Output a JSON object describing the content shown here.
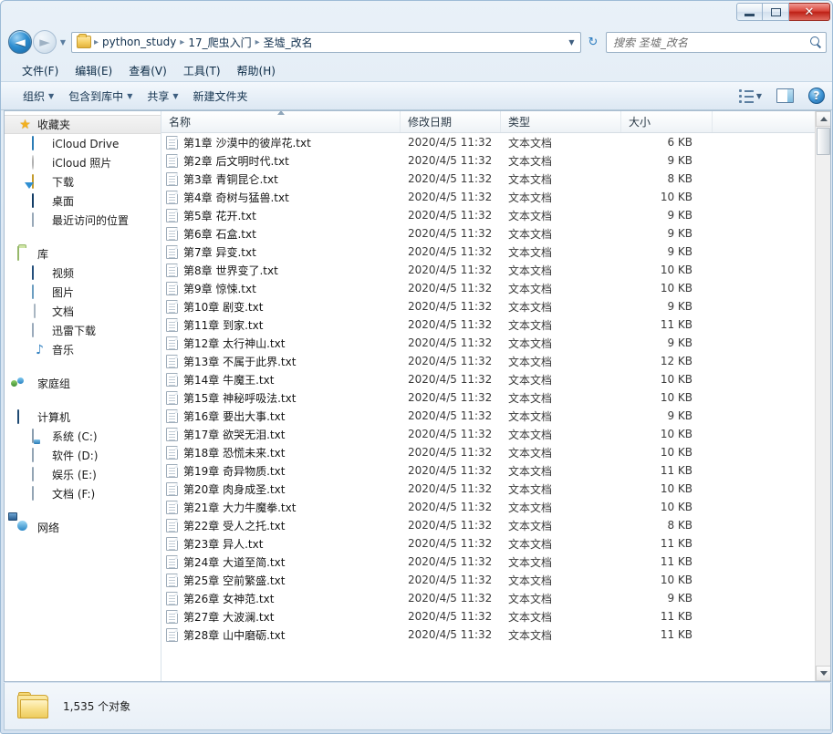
{
  "window": {
    "controls": {
      "minimize": "minimize-button",
      "maximize": "maximize-button",
      "close_label": "✕"
    }
  },
  "navigation": {
    "back_arrow": "◄",
    "forward_arrow": "►",
    "recent_arrow": "▼",
    "refresh_glyph": "↻",
    "breadcrumb": [
      "python_study",
      "17_爬虫入门",
      "圣墟_改名"
    ],
    "separator": "▸",
    "dropdown_arrow": "▼"
  },
  "search": {
    "placeholder": "搜索 圣墟_改名"
  },
  "menubar": {
    "items": [
      "文件(F)",
      "编辑(E)",
      "查看(V)",
      "工具(T)",
      "帮助(H)"
    ]
  },
  "toolbar": {
    "items": [
      {
        "label": "组织",
        "has_caret": true
      },
      {
        "label": "包含到库中",
        "has_caret": true
      },
      {
        "label": "共享",
        "has_caret": true
      },
      {
        "label": "新建文件夹",
        "has_caret": false
      }
    ],
    "caret": "▼",
    "help_label": "?"
  },
  "sidebar": {
    "groups": [
      {
        "header": {
          "label": "收藏夹",
          "icon": "star-icon",
          "selected": true
        },
        "items": [
          {
            "label": "iCloud Drive",
            "icon": "cloud-icon"
          },
          {
            "label": "iCloud 照片",
            "icon": "photos-icon"
          },
          {
            "label": "下载",
            "icon": "downloads-icon"
          },
          {
            "label": "桌面",
            "icon": "desktop-icon"
          },
          {
            "label": "最近访问的位置",
            "icon": "recent-places-icon"
          }
        ]
      },
      {
        "header": {
          "label": "库",
          "icon": "library-icon",
          "selected": false
        },
        "items": [
          {
            "label": "视频",
            "icon": "video-icon"
          },
          {
            "label": "图片",
            "icon": "pictures-icon"
          },
          {
            "label": "文档",
            "icon": "documents-icon"
          },
          {
            "label": "迅雷下载",
            "icon": "xunlei-icon"
          },
          {
            "label": "音乐",
            "icon": "music-icon"
          }
        ]
      },
      {
        "header": {
          "label": "家庭组",
          "icon": "homegroup-icon",
          "selected": false
        },
        "items": []
      },
      {
        "header": {
          "label": "计算机",
          "icon": "computer-icon",
          "selected": false
        },
        "items": [
          {
            "label": "系统 (C:)",
            "icon": "system-drive-icon"
          },
          {
            "label": "软件 (D:)",
            "icon": "drive-icon"
          },
          {
            "label": "娱乐 (E:)",
            "icon": "drive-icon"
          },
          {
            "label": "文档 (F:)",
            "icon": "drive-icon"
          }
        ]
      },
      {
        "header": {
          "label": "网络",
          "icon": "network-icon",
          "selected": false
        },
        "items": []
      }
    ]
  },
  "filelist": {
    "columns": [
      {
        "key": "name",
        "label": "名称",
        "sorted": true
      },
      {
        "key": "date",
        "label": "修改日期",
        "sorted": false
      },
      {
        "key": "type",
        "label": "类型",
        "sorted": false
      },
      {
        "key": "size",
        "label": "大小",
        "sorted": false
      }
    ],
    "rows": [
      {
        "name": "第1章 沙漠中的彼岸花.txt",
        "date": "2020/4/5 11:32",
        "type": "文本文档",
        "size": "6 KB"
      },
      {
        "name": "第2章 后文明时代.txt",
        "date": "2020/4/5 11:32",
        "type": "文本文档",
        "size": "9 KB"
      },
      {
        "name": "第3章 青铜昆仑.txt",
        "date": "2020/4/5 11:32",
        "type": "文本文档",
        "size": "8 KB"
      },
      {
        "name": "第4章 奇树与猛兽.txt",
        "date": "2020/4/5 11:32",
        "type": "文本文档",
        "size": "10 KB"
      },
      {
        "name": "第5章 花开.txt",
        "date": "2020/4/5 11:32",
        "type": "文本文档",
        "size": "9 KB"
      },
      {
        "name": "第6章 石盒.txt",
        "date": "2020/4/5 11:32",
        "type": "文本文档",
        "size": "9 KB"
      },
      {
        "name": "第7章 异变.txt",
        "date": "2020/4/5 11:32",
        "type": "文本文档",
        "size": "9 KB"
      },
      {
        "name": "第8章 世界变了.txt",
        "date": "2020/4/5 11:32",
        "type": "文本文档",
        "size": "10 KB"
      },
      {
        "name": "第9章 惊悚.txt",
        "date": "2020/4/5 11:32",
        "type": "文本文档",
        "size": "10 KB"
      },
      {
        "name": "第10章 剧变.txt",
        "date": "2020/4/5 11:32",
        "type": "文本文档",
        "size": "9 KB"
      },
      {
        "name": "第11章 到家.txt",
        "date": "2020/4/5 11:32",
        "type": "文本文档",
        "size": "11 KB"
      },
      {
        "name": "第12章 太行神山.txt",
        "date": "2020/4/5 11:32",
        "type": "文本文档",
        "size": "9 KB"
      },
      {
        "name": "第13章 不属于此界.txt",
        "date": "2020/4/5 11:32",
        "type": "文本文档",
        "size": "12 KB"
      },
      {
        "name": "第14章 牛魔王.txt",
        "date": "2020/4/5 11:32",
        "type": "文本文档",
        "size": "10 KB"
      },
      {
        "name": "第15章 神秘呼吸法.txt",
        "date": "2020/4/5 11:32",
        "type": "文本文档",
        "size": "10 KB"
      },
      {
        "name": "第16章 要出大事.txt",
        "date": "2020/4/5 11:32",
        "type": "文本文档",
        "size": "9 KB"
      },
      {
        "name": "第17章 欲哭无泪.txt",
        "date": "2020/4/5 11:32",
        "type": "文本文档",
        "size": "10 KB"
      },
      {
        "name": "第18章 恐慌未来.txt",
        "date": "2020/4/5 11:32",
        "type": "文本文档",
        "size": "10 KB"
      },
      {
        "name": "第19章 奇异物质.txt",
        "date": "2020/4/5 11:32",
        "type": "文本文档",
        "size": "11 KB"
      },
      {
        "name": "第20章 肉身成圣.txt",
        "date": "2020/4/5 11:32",
        "type": "文本文档",
        "size": "10 KB"
      },
      {
        "name": "第21章 大力牛魔拳.txt",
        "date": "2020/4/5 11:32",
        "type": "文本文档",
        "size": "10 KB"
      },
      {
        "name": "第22章 受人之托.txt",
        "date": "2020/4/5 11:32",
        "type": "文本文档",
        "size": "8 KB"
      },
      {
        "name": "第23章 异人.txt",
        "date": "2020/4/5 11:32",
        "type": "文本文档",
        "size": "11 KB"
      },
      {
        "name": "第24章 大道至简.txt",
        "date": "2020/4/5 11:32",
        "type": "文本文档",
        "size": "11 KB"
      },
      {
        "name": "第25章 空前繁盛.txt",
        "date": "2020/4/5 11:32",
        "type": "文本文档",
        "size": "10 KB"
      },
      {
        "name": "第26章 女神范.txt",
        "date": "2020/4/5 11:32",
        "type": "文本文档",
        "size": "9 KB"
      },
      {
        "name": "第27章 大波澜.txt",
        "date": "2020/4/5 11:32",
        "type": "文本文档",
        "size": "11 KB"
      },
      {
        "name": "第28章 山中磨砺.txt",
        "date": "2020/4/5 11:32",
        "type": "文本文档",
        "size": "11 KB"
      }
    ]
  },
  "statusbar": {
    "item_count": "1,535 个对象"
  },
  "colors": {
    "accent": "#2f8fd2",
    "close_button": "#bd2016",
    "folder_yellow": "#f2d264",
    "selection": "#e9f4fd"
  }
}
